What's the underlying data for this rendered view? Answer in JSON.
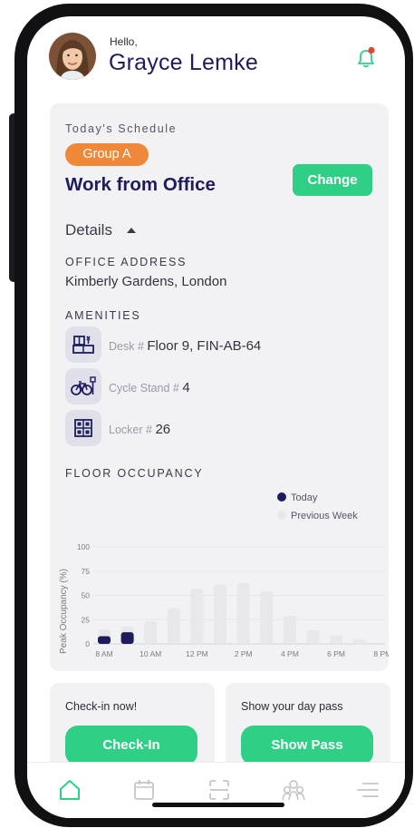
{
  "header": {
    "greeting": "Hello,",
    "user_name": "Grayce Lemke"
  },
  "schedule": {
    "section_label": "Today's Schedule",
    "group_badge": "Group A",
    "work_mode": "Work from Office",
    "change_label": "Change",
    "details_label": "Details",
    "office_address_label": "OFFICE ADDRESS",
    "office_address": "Kimberly Gardens, London",
    "amenities_label": "AMENITIES",
    "amenities": [
      {
        "icon": "desk-icon",
        "key": "Desk #",
        "value": "Floor 9, FIN-AB-64"
      },
      {
        "icon": "bicycle-icon",
        "key": "Cycle Stand #",
        "value": "4"
      },
      {
        "icon": "locker-icon",
        "key": "Locker #",
        "value": "26"
      }
    ],
    "floor_occupancy_label": "FLOOR OCCUPANCY"
  },
  "chart_data": {
    "type": "bar",
    "categories": [
      "8 AM",
      "9 AM",
      "10 AM",
      "11 AM",
      "12 PM",
      "1 PM",
      "2 PM",
      "3 PM",
      "4 PM",
      "5 PM",
      "6 PM",
      "7 PM",
      "8 PM"
    ],
    "x_tick_labels": [
      "8 AM",
      "10 AM",
      "12 PM",
      "2 PM",
      "4 PM",
      "6 PM",
      "8 PM"
    ],
    "series": [
      {
        "name": "Today",
        "color": "#1e1c5c",
        "values": [
          8,
          12,
          null,
          null,
          null,
          null,
          null,
          null,
          null,
          null,
          null,
          null,
          null
        ]
      },
      {
        "name": "Previous Week",
        "color": "#e8e8ea",
        "values": [
          15,
          18,
          23,
          37,
          57,
          61,
          63,
          54,
          29,
          14,
          9,
          5,
          null
        ]
      }
    ],
    "ylabel": "Peak Occupancy (%)",
    "ylim": [
      0,
      100
    ],
    "yticks": [
      0,
      25,
      50,
      75,
      100
    ],
    "grid": true,
    "legend_position": "top-right"
  },
  "checkin": {
    "title": "Check-in now!",
    "button_label": "Check-In"
  },
  "daypass": {
    "title": "Show your day pass",
    "button_label": "Show Pass"
  },
  "nav": {
    "items": [
      "home-icon",
      "calendar-icon",
      "scan-icon",
      "community-icon",
      "menu-icon"
    ],
    "active_color": "#2fcf86",
    "inactive_color": "#c4c4cc"
  },
  "colors": {
    "accent": "#2fcf86",
    "brand_navy": "#1e1c5c",
    "badge_orange": "#f0883a",
    "notification_dot": "#e8413c"
  }
}
